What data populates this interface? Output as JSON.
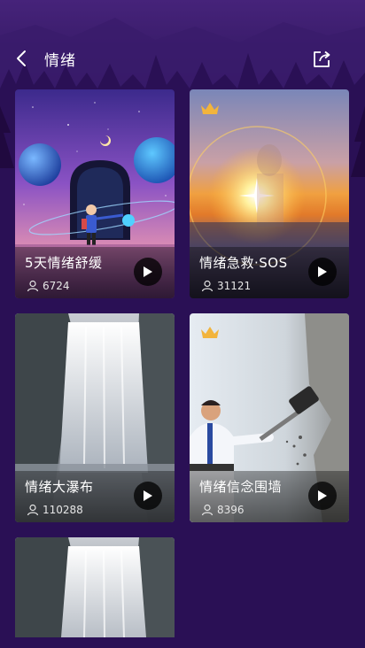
{
  "header": {
    "title": "情绪",
    "back_icon": "chevron-left-icon",
    "share_icon": "share-icon"
  },
  "cards": [
    {
      "title": "5天情绪舒缓",
      "count": "6724",
      "vip": false
    },
    {
      "title": "情绪急救·SOS",
      "count": "31121",
      "vip": true
    },
    {
      "title": "情绪大瀑布",
      "count": "110288",
      "vip": false
    },
    {
      "title": "情绪信念围墙",
      "count": "8396",
      "vip": true
    },
    {
      "title": "",
      "count": "",
      "vip": false
    }
  ],
  "colors": {
    "background": "#2a1153",
    "crown": "#f2b43c"
  }
}
